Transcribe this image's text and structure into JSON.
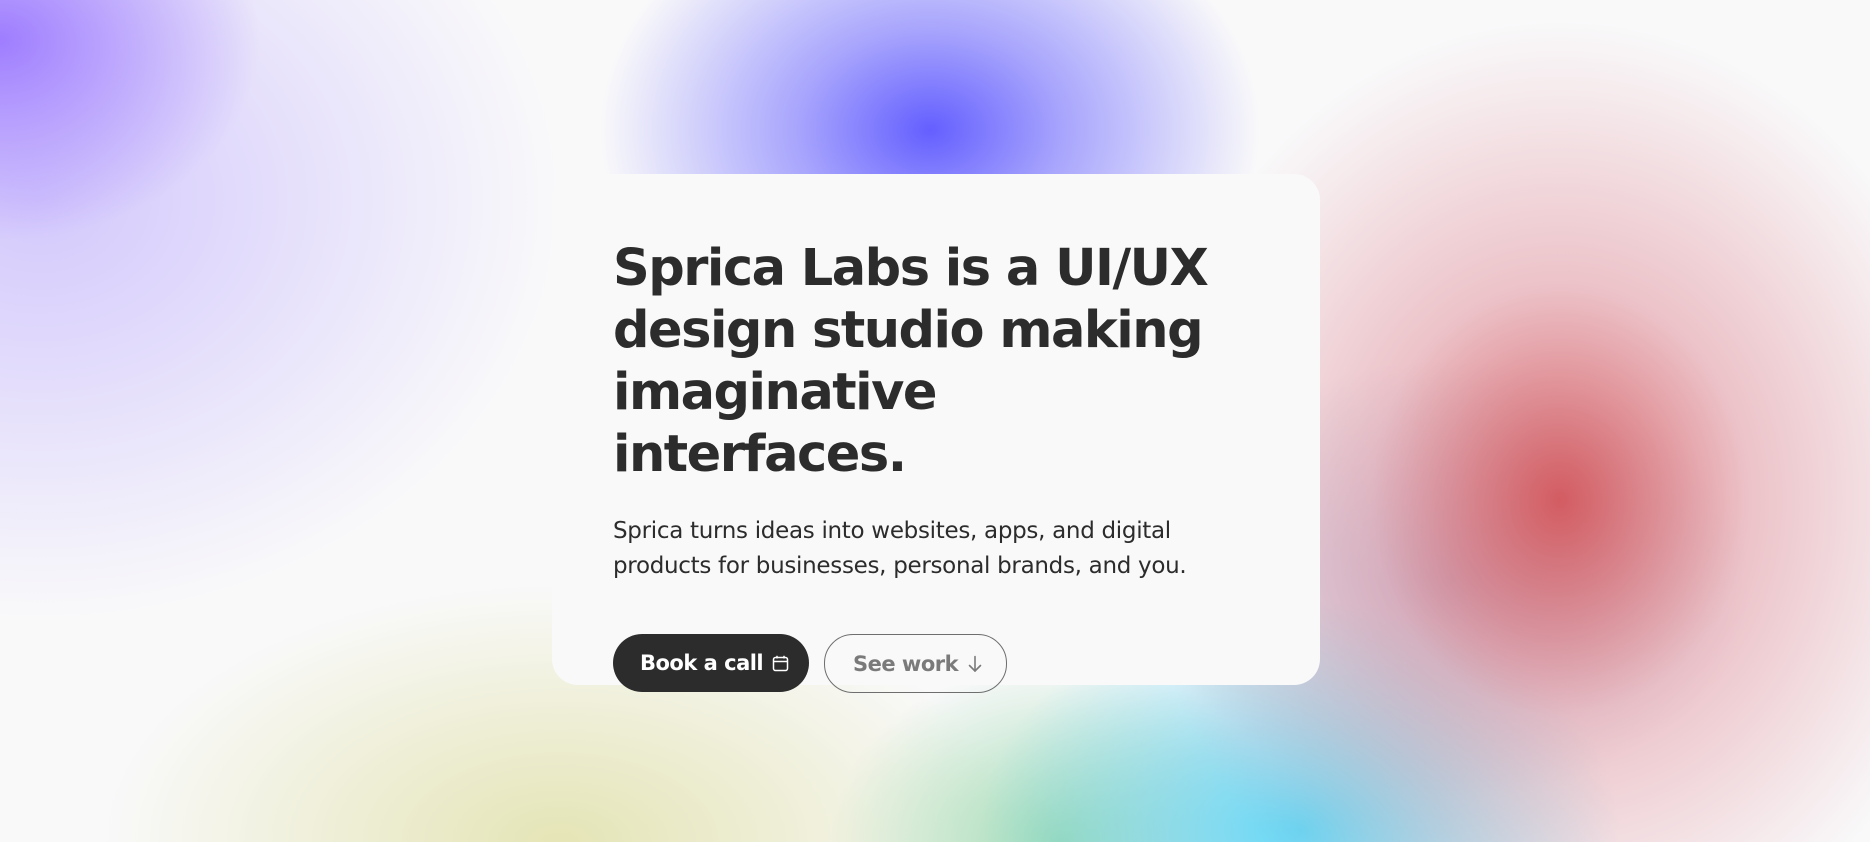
{
  "hero": {
    "headline": "Sprica Labs is a UI/UX design studio making imaginative interfaces.",
    "subtitle": "Sprica turns ideas into websites, apps, and digital products for businesses, personal brands, and you."
  },
  "actions": {
    "book_call_label": "Book a call",
    "book_call_icon": "calendar-icon",
    "see_work_label": "See work",
    "see_work_icon": "arrow-down-icon"
  },
  "colors": {
    "text": "#2c2c2c",
    "card_background": "#f9f9f9",
    "primary_button": "#2c2c2c",
    "secondary_text": "#7a7a7a"
  }
}
